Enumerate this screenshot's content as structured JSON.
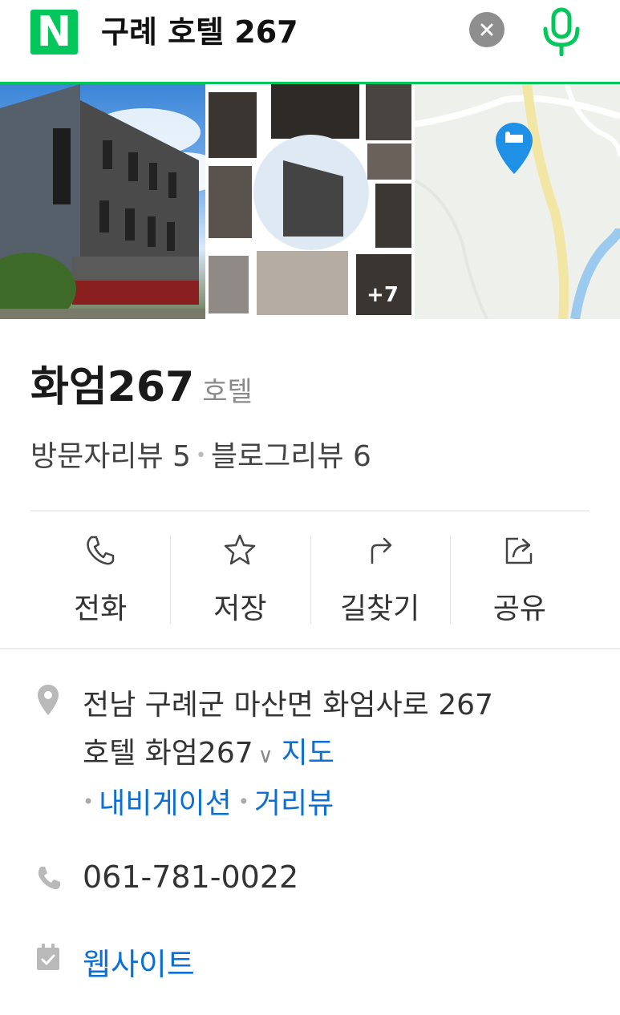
{
  "search": {
    "logo_letter": "N",
    "query": "구례 호텔 267"
  },
  "media": {
    "more_photos": "+7"
  },
  "place": {
    "name": "화엄267",
    "category": "호텔",
    "visitor_reviews": "방문자리뷰 5",
    "blog_reviews": "블로그리뷰 6"
  },
  "actions": [
    {
      "label": "전화",
      "icon": "phone-icon"
    },
    {
      "label": "저장",
      "icon": "star-icon"
    },
    {
      "label": "길찾기",
      "icon": "directions-icon"
    },
    {
      "label": "공유",
      "icon": "share-icon"
    }
  ],
  "info": {
    "address_line1": "전남 구례군 마산면 화엄사로 267",
    "address_line2": "호텔 화엄267",
    "map_link": "지도",
    "navigation_link": "내비게이션",
    "streetview_link": "거리뷰",
    "phone": "061-781-0022",
    "website_label": "웹사이트"
  },
  "colors": {
    "brand": "#03c75a",
    "link": "#0b6fd3",
    "map_pin": "#1e90e6"
  }
}
